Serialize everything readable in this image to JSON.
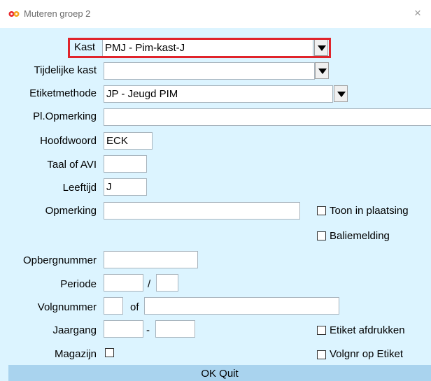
{
  "window": {
    "title": "Muteren groep 2",
    "close_label": "×"
  },
  "fields": {
    "kast": {
      "label": "Kast",
      "value": "PMJ - Pim-kast-J"
    },
    "tijdelijke_kast": {
      "label": "Tijdelijke kast",
      "value": ""
    },
    "etiketmethode": {
      "label": "Etiketmethode",
      "value": "JP - Jeugd PIM"
    },
    "pl_opmerking": {
      "label": "Pl.Opmerking",
      "value": ""
    },
    "hoofdwoord": {
      "label": "Hoofdwoord",
      "value": "ECK"
    },
    "taal_of_avi": {
      "label": "Taal of AVI",
      "value": ""
    },
    "leeftijd": {
      "label": "Leeftijd",
      "value": "J"
    },
    "opmerking": {
      "label": "Opmerking",
      "value": ""
    },
    "opbergnummer": {
      "label": "Opbergnummer",
      "value": ""
    },
    "periode": {
      "label": "Periode",
      "value1": "",
      "sep": "/",
      "value2": ""
    },
    "volgnummer": {
      "label": "Volgnummer",
      "value1": "",
      "sep": "of",
      "value2": ""
    },
    "jaargang": {
      "label": "Jaargang",
      "value1": "",
      "sep": "-",
      "value2": ""
    },
    "magazijn": {
      "label": "Magazijn",
      "checked": false
    }
  },
  "checkboxes": {
    "toon_in_plaatsing": {
      "label": "Toon in plaatsing",
      "checked": false
    },
    "baliemelding": {
      "label": "Baliemelding",
      "checked": false
    },
    "etiket_afdrukken": {
      "label": "Etiket afdrukken",
      "checked": false
    },
    "volgnr_op_etiket": {
      "label": "Volgnr op Etiket",
      "checked": false
    }
  },
  "bottom": {
    "text": "OK   Quit"
  },
  "colors": {
    "highlight": "#e0242b",
    "background": "#dcf4ff",
    "bottom_bar": "#a9d3ee"
  }
}
